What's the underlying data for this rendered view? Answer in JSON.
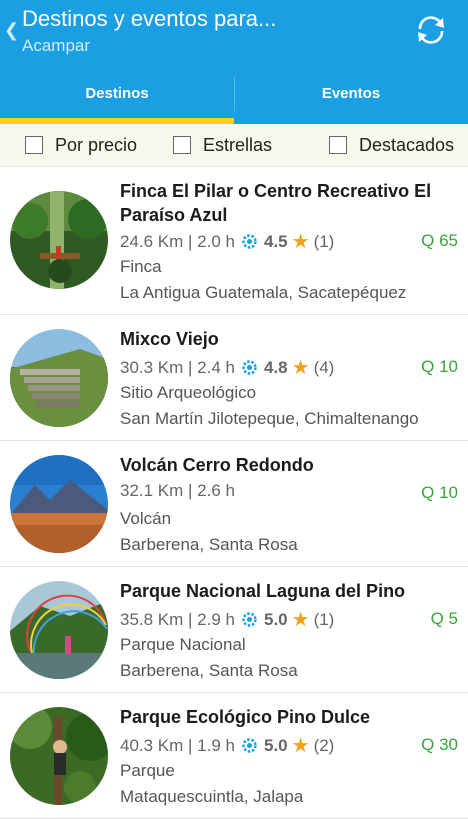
{
  "header": {
    "title": "Destinos y eventos para...",
    "subtitle": "Acampar",
    "back_glyph": "❮",
    "refresh_icon": "refresh-icon"
  },
  "tabs": [
    {
      "label": "Destinos",
      "active": true
    },
    {
      "label": "Eventos",
      "active": false
    }
  ],
  "filters": [
    {
      "label": "Por precio",
      "checked": false
    },
    {
      "label": "Estrellas",
      "checked": false
    },
    {
      "label": "Destacados",
      "checked": false
    }
  ],
  "items": [
    {
      "name": "Finca El Pilar o Centro Recreativo El Paraíso Azul",
      "distance": "24.6 Km | 2.0 h",
      "rating": "4.5",
      "reviews": "(1)",
      "type": "Finca",
      "location": "La Antigua Guatemala, Sacatepéquez",
      "price": "Q 65"
    },
    {
      "name": "Mixco Viejo",
      "distance": "30.3 Km | 2.4 h",
      "rating": "4.8",
      "reviews": "(4)",
      "type": "Sitio Arqueológico",
      "location": "San Martín Jilotepeque, Chimaltenango",
      "price": "Q 10"
    },
    {
      "name": "Volcán Cerro Redondo",
      "distance": "32.1 Km | 2.6 h",
      "rating": "",
      "reviews": "",
      "type": "Volcán",
      "location": "Barberena, Santa Rosa",
      "price": "Q 10"
    },
    {
      "name": "Parque Nacional Laguna del Pino",
      "distance": "35.8 Km | 2.9 h",
      "rating": "5.0",
      "reviews": "(1)",
      "type": "Parque Nacional",
      "location": "Barberena, Santa Rosa",
      "price": "Q 5"
    },
    {
      "name": "Parque Ecológico Pino Dulce",
      "distance": "40.3 Km | 1.9 h",
      "rating": "5.0",
      "reviews": "(2)",
      "type": "Parque",
      "location": "Mataquescuintla, Jalapa",
      "price": "Q 30"
    }
  ],
  "colors": {
    "primary": "#1aa0e2",
    "tab_indicator": "#f6d21a",
    "price": "#36a53a",
    "star": "#f0a31a",
    "gear": "#1aa0e2"
  }
}
